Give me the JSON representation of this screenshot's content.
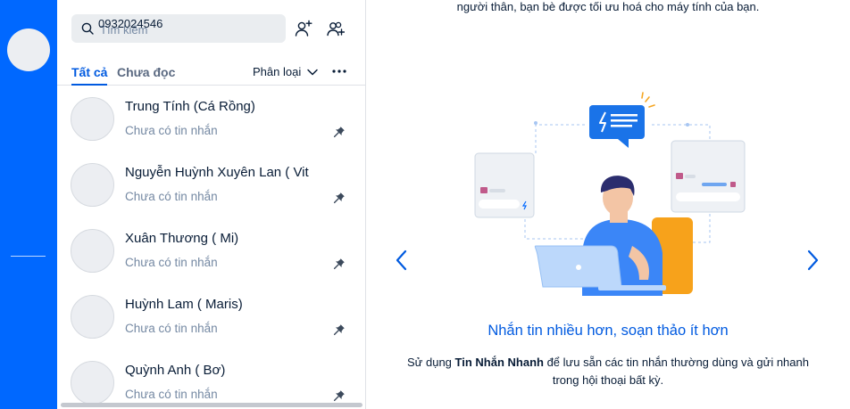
{
  "search": {
    "placeholder": "Tìm kiếm",
    "typed_value": "0932024546"
  },
  "tabs": {
    "all": "Tất cả",
    "unread": "Chưa đọc",
    "classify": "Phân loại"
  },
  "conversations": [
    {
      "name": "Trung Tính (Cá Rồng)",
      "preview": "Chưa có tin nhắn"
    },
    {
      "name": "Nguyễn Huỳnh Xuyên Lan ( Vit",
      "preview": "Chưa có tin nhắn"
    },
    {
      "name": "Xuân Thương ( Mi)",
      "preview": "Chưa có tin nhắn"
    },
    {
      "name": "Huỳnh Lam ( Maris)",
      "preview": "Chưa có tin nhắn"
    },
    {
      "name": "Quỳnh Anh ( Bơ)",
      "preview": "Chưa có tin nhắn"
    }
  ],
  "welcome": {
    "top_text": "người thân, bạn bè được tối ưu hoá cho máy tính của bạn.",
    "slide_title": "Nhắn tin nhiều hơn, soạn thảo ít hơn",
    "desc_prefix": "Sử dụng ",
    "desc_bold": "Tin Nhắn Nhanh",
    "desc_suffix": " để lưu sẵn các tin nhắn thường dùng và gửi nhanh trong hội thoại bất kỳ."
  },
  "colors": {
    "brand": "#0068ff",
    "accent_text": "#005ae0",
    "muted_text": "#7589a3"
  },
  "icons": {
    "search": "search-icon",
    "add_friend": "add-friend-icon",
    "create_group": "create-group-icon",
    "chevron": "chevron-down-icon",
    "more": "more-horizontal-icon",
    "pin": "pin-icon",
    "prev": "chevron-left-icon",
    "next": "chevron-right-icon"
  }
}
